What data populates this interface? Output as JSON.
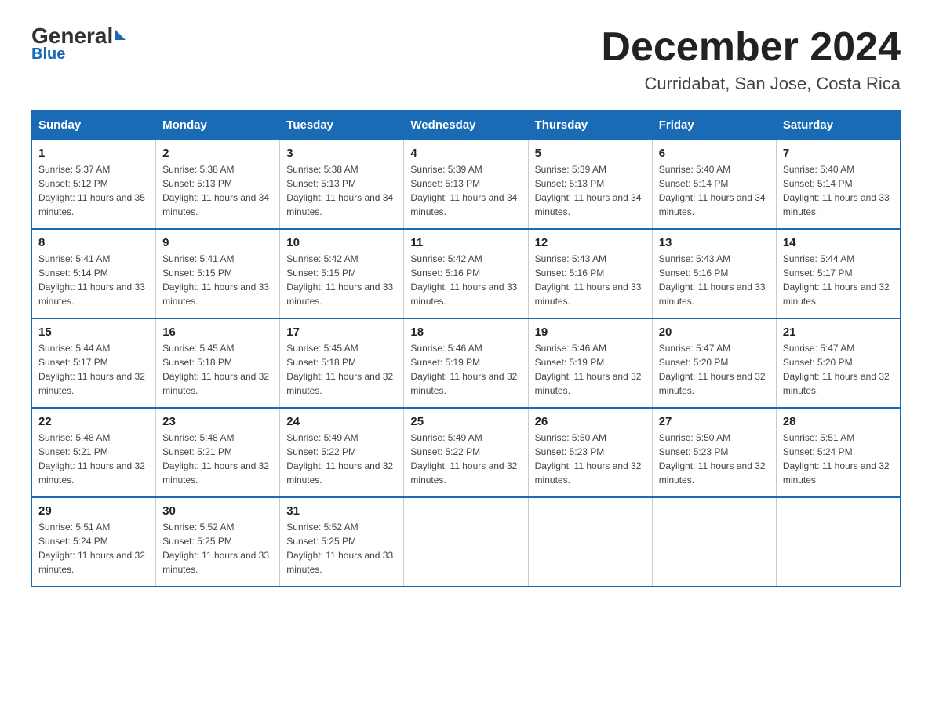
{
  "logo": {
    "general": "General",
    "triangle": "",
    "blue": "Blue"
  },
  "header": {
    "title": "December 2024",
    "subtitle": "Curridabat, San Jose, Costa Rica"
  },
  "days_of_week": [
    "Sunday",
    "Monday",
    "Tuesday",
    "Wednesday",
    "Thursday",
    "Friday",
    "Saturday"
  ],
  "weeks": [
    [
      {
        "day": "1",
        "sunrise": "5:37 AM",
        "sunset": "5:12 PM",
        "daylight": "11 hours and 35 minutes."
      },
      {
        "day": "2",
        "sunrise": "5:38 AM",
        "sunset": "5:13 PM",
        "daylight": "11 hours and 34 minutes."
      },
      {
        "day": "3",
        "sunrise": "5:38 AM",
        "sunset": "5:13 PM",
        "daylight": "11 hours and 34 minutes."
      },
      {
        "day": "4",
        "sunrise": "5:39 AM",
        "sunset": "5:13 PM",
        "daylight": "11 hours and 34 minutes."
      },
      {
        "day": "5",
        "sunrise": "5:39 AM",
        "sunset": "5:13 PM",
        "daylight": "11 hours and 34 minutes."
      },
      {
        "day": "6",
        "sunrise": "5:40 AM",
        "sunset": "5:14 PM",
        "daylight": "11 hours and 34 minutes."
      },
      {
        "day": "7",
        "sunrise": "5:40 AM",
        "sunset": "5:14 PM",
        "daylight": "11 hours and 33 minutes."
      }
    ],
    [
      {
        "day": "8",
        "sunrise": "5:41 AM",
        "sunset": "5:14 PM",
        "daylight": "11 hours and 33 minutes."
      },
      {
        "day": "9",
        "sunrise": "5:41 AM",
        "sunset": "5:15 PM",
        "daylight": "11 hours and 33 minutes."
      },
      {
        "day": "10",
        "sunrise": "5:42 AM",
        "sunset": "5:15 PM",
        "daylight": "11 hours and 33 minutes."
      },
      {
        "day": "11",
        "sunrise": "5:42 AM",
        "sunset": "5:16 PM",
        "daylight": "11 hours and 33 minutes."
      },
      {
        "day": "12",
        "sunrise": "5:43 AM",
        "sunset": "5:16 PM",
        "daylight": "11 hours and 33 minutes."
      },
      {
        "day": "13",
        "sunrise": "5:43 AM",
        "sunset": "5:16 PM",
        "daylight": "11 hours and 33 minutes."
      },
      {
        "day": "14",
        "sunrise": "5:44 AM",
        "sunset": "5:17 PM",
        "daylight": "11 hours and 32 minutes."
      }
    ],
    [
      {
        "day": "15",
        "sunrise": "5:44 AM",
        "sunset": "5:17 PM",
        "daylight": "11 hours and 32 minutes."
      },
      {
        "day": "16",
        "sunrise": "5:45 AM",
        "sunset": "5:18 PM",
        "daylight": "11 hours and 32 minutes."
      },
      {
        "day": "17",
        "sunrise": "5:45 AM",
        "sunset": "5:18 PM",
        "daylight": "11 hours and 32 minutes."
      },
      {
        "day": "18",
        "sunrise": "5:46 AM",
        "sunset": "5:19 PM",
        "daylight": "11 hours and 32 minutes."
      },
      {
        "day": "19",
        "sunrise": "5:46 AM",
        "sunset": "5:19 PM",
        "daylight": "11 hours and 32 minutes."
      },
      {
        "day": "20",
        "sunrise": "5:47 AM",
        "sunset": "5:20 PM",
        "daylight": "11 hours and 32 minutes."
      },
      {
        "day": "21",
        "sunrise": "5:47 AM",
        "sunset": "5:20 PM",
        "daylight": "11 hours and 32 minutes."
      }
    ],
    [
      {
        "day": "22",
        "sunrise": "5:48 AM",
        "sunset": "5:21 PM",
        "daylight": "11 hours and 32 minutes."
      },
      {
        "day": "23",
        "sunrise": "5:48 AM",
        "sunset": "5:21 PM",
        "daylight": "11 hours and 32 minutes."
      },
      {
        "day": "24",
        "sunrise": "5:49 AM",
        "sunset": "5:22 PM",
        "daylight": "11 hours and 32 minutes."
      },
      {
        "day": "25",
        "sunrise": "5:49 AM",
        "sunset": "5:22 PM",
        "daylight": "11 hours and 32 minutes."
      },
      {
        "day": "26",
        "sunrise": "5:50 AM",
        "sunset": "5:23 PM",
        "daylight": "11 hours and 32 minutes."
      },
      {
        "day": "27",
        "sunrise": "5:50 AM",
        "sunset": "5:23 PM",
        "daylight": "11 hours and 32 minutes."
      },
      {
        "day": "28",
        "sunrise": "5:51 AM",
        "sunset": "5:24 PM",
        "daylight": "11 hours and 32 minutes."
      }
    ],
    [
      {
        "day": "29",
        "sunrise": "5:51 AM",
        "sunset": "5:24 PM",
        "daylight": "11 hours and 32 minutes."
      },
      {
        "day": "30",
        "sunrise": "5:52 AM",
        "sunset": "5:25 PM",
        "daylight": "11 hours and 33 minutes."
      },
      {
        "day": "31",
        "sunrise": "5:52 AM",
        "sunset": "5:25 PM",
        "daylight": "11 hours and 33 minutes."
      },
      null,
      null,
      null,
      null
    ]
  ]
}
